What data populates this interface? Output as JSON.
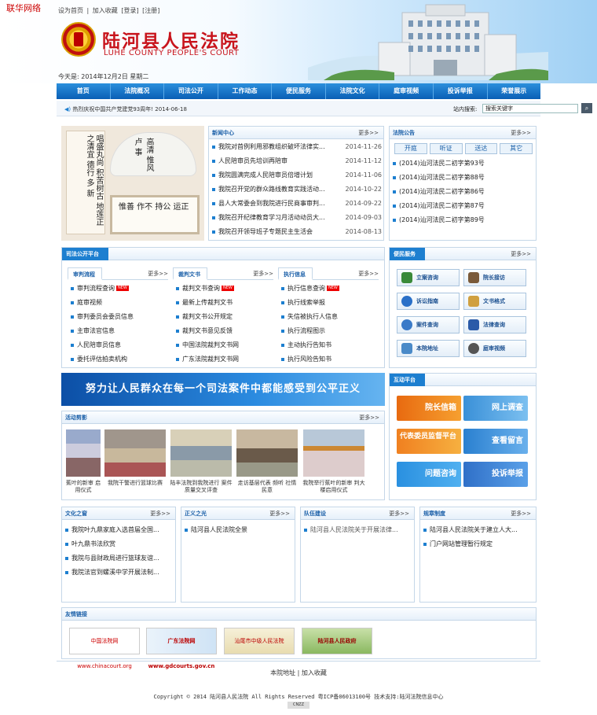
{
  "corner_logo": "联华网络",
  "top_links": [
    "设为首页",
    "|",
    "加入收藏",
    "[登录]",
    "[注册]"
  ],
  "site_title": "陆河县人民法院",
  "site_subtitle": "LUHE COUNTY PEOPLE'S COURT",
  "date_text": "今天是:  2014年12月2日  星期二",
  "nav": [
    "首页",
    "法院概况",
    "司法公开",
    "工作动态",
    "便民服务",
    "法院文化",
    "庭审视频",
    "投诉举报",
    "荣誉展示"
  ],
  "ticker": {
    "message": "热烈庆祝中国共产党建党93周年!  2014-06-18",
    "search_label": "站内搜索:",
    "search_placeholder": "搜索关键字"
  },
  "calligraphy": {
    "left": "唱盛丸尚 积苦树古 地莲正 之清宜 德行 多 新",
    "fan": "高清 惟风 卢 事",
    "panel": "惟善 作不 持公 运正"
  },
  "news": {
    "title": "新闻中心",
    "more": "更多>>",
    "items": [
      {
        "text": "我院对首例利用邪教组织破坏法律实...",
        "date": "2014-11-26"
      },
      {
        "text": "人民陪审员先培训再陪审",
        "date": "2014-11-12"
      },
      {
        "text": "我院圆满完成人民陪审员倍增计划",
        "date": "2014-11-06"
      },
      {
        "text": "我院召开党的群众路线教育实践活动...",
        "date": "2014-10-22"
      },
      {
        "text": "县人大常委会到我院进行民商事审判...",
        "date": "2014-09-22"
      },
      {
        "text": "我院召开纪律教育学习月活动动员大...",
        "date": "2014-09-03"
      },
      {
        "text": "我院召开领导班子专题民主生活会",
        "date": "2014-08-13"
      }
    ]
  },
  "notice": {
    "title": "法院公告",
    "more": "更多>>",
    "buttons": [
      "开庭",
      "听证",
      "送达",
      "其它"
    ],
    "items": [
      "(2014)汕河法民二初字第93号",
      "(2014)汕河法民二初字第88号",
      "(2014)汕河法民二初字第86号",
      "(2014)汕河法民二初字第87号",
      "(2014)汕河法民二初字第89号"
    ]
  },
  "judicial": {
    "title": "司法公开平台",
    "sections": [
      {
        "title": "审判流程",
        "more": "更多>>",
        "items": [
          "审判流程查询",
          "庭审视频",
          "审判委员会委员信息",
          "主审法官信息",
          "人民陪审员信息",
          "委托评估拍卖机构"
        ],
        "new_index": 0
      },
      {
        "title": "裁判文书",
        "more": "更多>>",
        "items": [
          "裁判文书查询",
          "最新上传裁判文书",
          "裁判文书公开规定",
          "裁判文书意见反馈",
          "中国法院裁判文书网",
          "广东法院裁判文书网"
        ],
        "new_index": 0
      },
      {
        "title": "执行信息",
        "more": "更多>>",
        "items": [
          "执行信息查询",
          "执行线索举报",
          "失信被执行人信息",
          "执行流程图示",
          "主动执行告知书",
          "执行风险告知书"
        ],
        "new_index": 0
      }
    ],
    "new_badge": "NEW"
  },
  "service": {
    "title": "便民服务",
    "more": "更多>>",
    "items": [
      "立案咨询",
      "院长接访",
      "诉讼指南",
      "文书格式",
      "案件查询",
      "法律查询",
      "本院地址",
      "庭审视频"
    ]
  },
  "slogan": "努力让人民群众在每一个司法案件中都能感受到公平正义",
  "activities": {
    "title": "活动剪影",
    "more": "更多>>",
    "captions": [
      "蕉叶的新审 启用仪式",
      "我院干警进行篮球比赛",
      "陆丰法院到我院进行 案件质量交叉评查",
      "走访基层代表 频听 社情民意",
      "我院举行蕉叶的新审 判大楼启用仪式"
    ]
  },
  "interactive": {
    "title": "互动平台",
    "items": [
      "院长信箱",
      "网上调查",
      "代表委员监督平台",
      "查看留言",
      "问题咨询",
      "投诉举报"
    ]
  },
  "bottom_boxes": [
    {
      "title": "文化之窗",
      "more": "更多>>",
      "items": [
        "我院叶九鼎家庭入选首届全国...",
        "叶九鼎书法欣赏",
        "我院与县财政局进行篮球友谊...",
        "我院法官到螺溪中学开展法制..."
      ]
    },
    {
      "title": "正义之光",
      "more": "更多>>",
      "items": [
        "陆河县人民法院全景"
      ]
    },
    {
      "title": "队伍建设",
      "more": "更多>>",
      "items": [
        "我院关于开展法律..."
      ]
    },
    {
      "title": "规章制度",
      "more": "更多>>",
      "items": [
        "陆河县人民法院关于建立人大...",
        "门户网站管理暂行规定"
      ]
    }
  ],
  "friend_links": {
    "title": "友情链接",
    "items": [
      "中国法院网 www.chinacourt.org",
      "广东法院网 www.gdcourts.gov.cn",
      "汕尾市中级人民法院",
      "陆河县人民政府"
    ]
  },
  "footer_links": "本院地址 | 加入收藏",
  "copyright": "Copyright © 2014 陆河县人民法院 All Rights Reserved 粤ICP备06013100号 技术支持:陆河法院信息中心",
  "cnzz": "CNZZ"
}
